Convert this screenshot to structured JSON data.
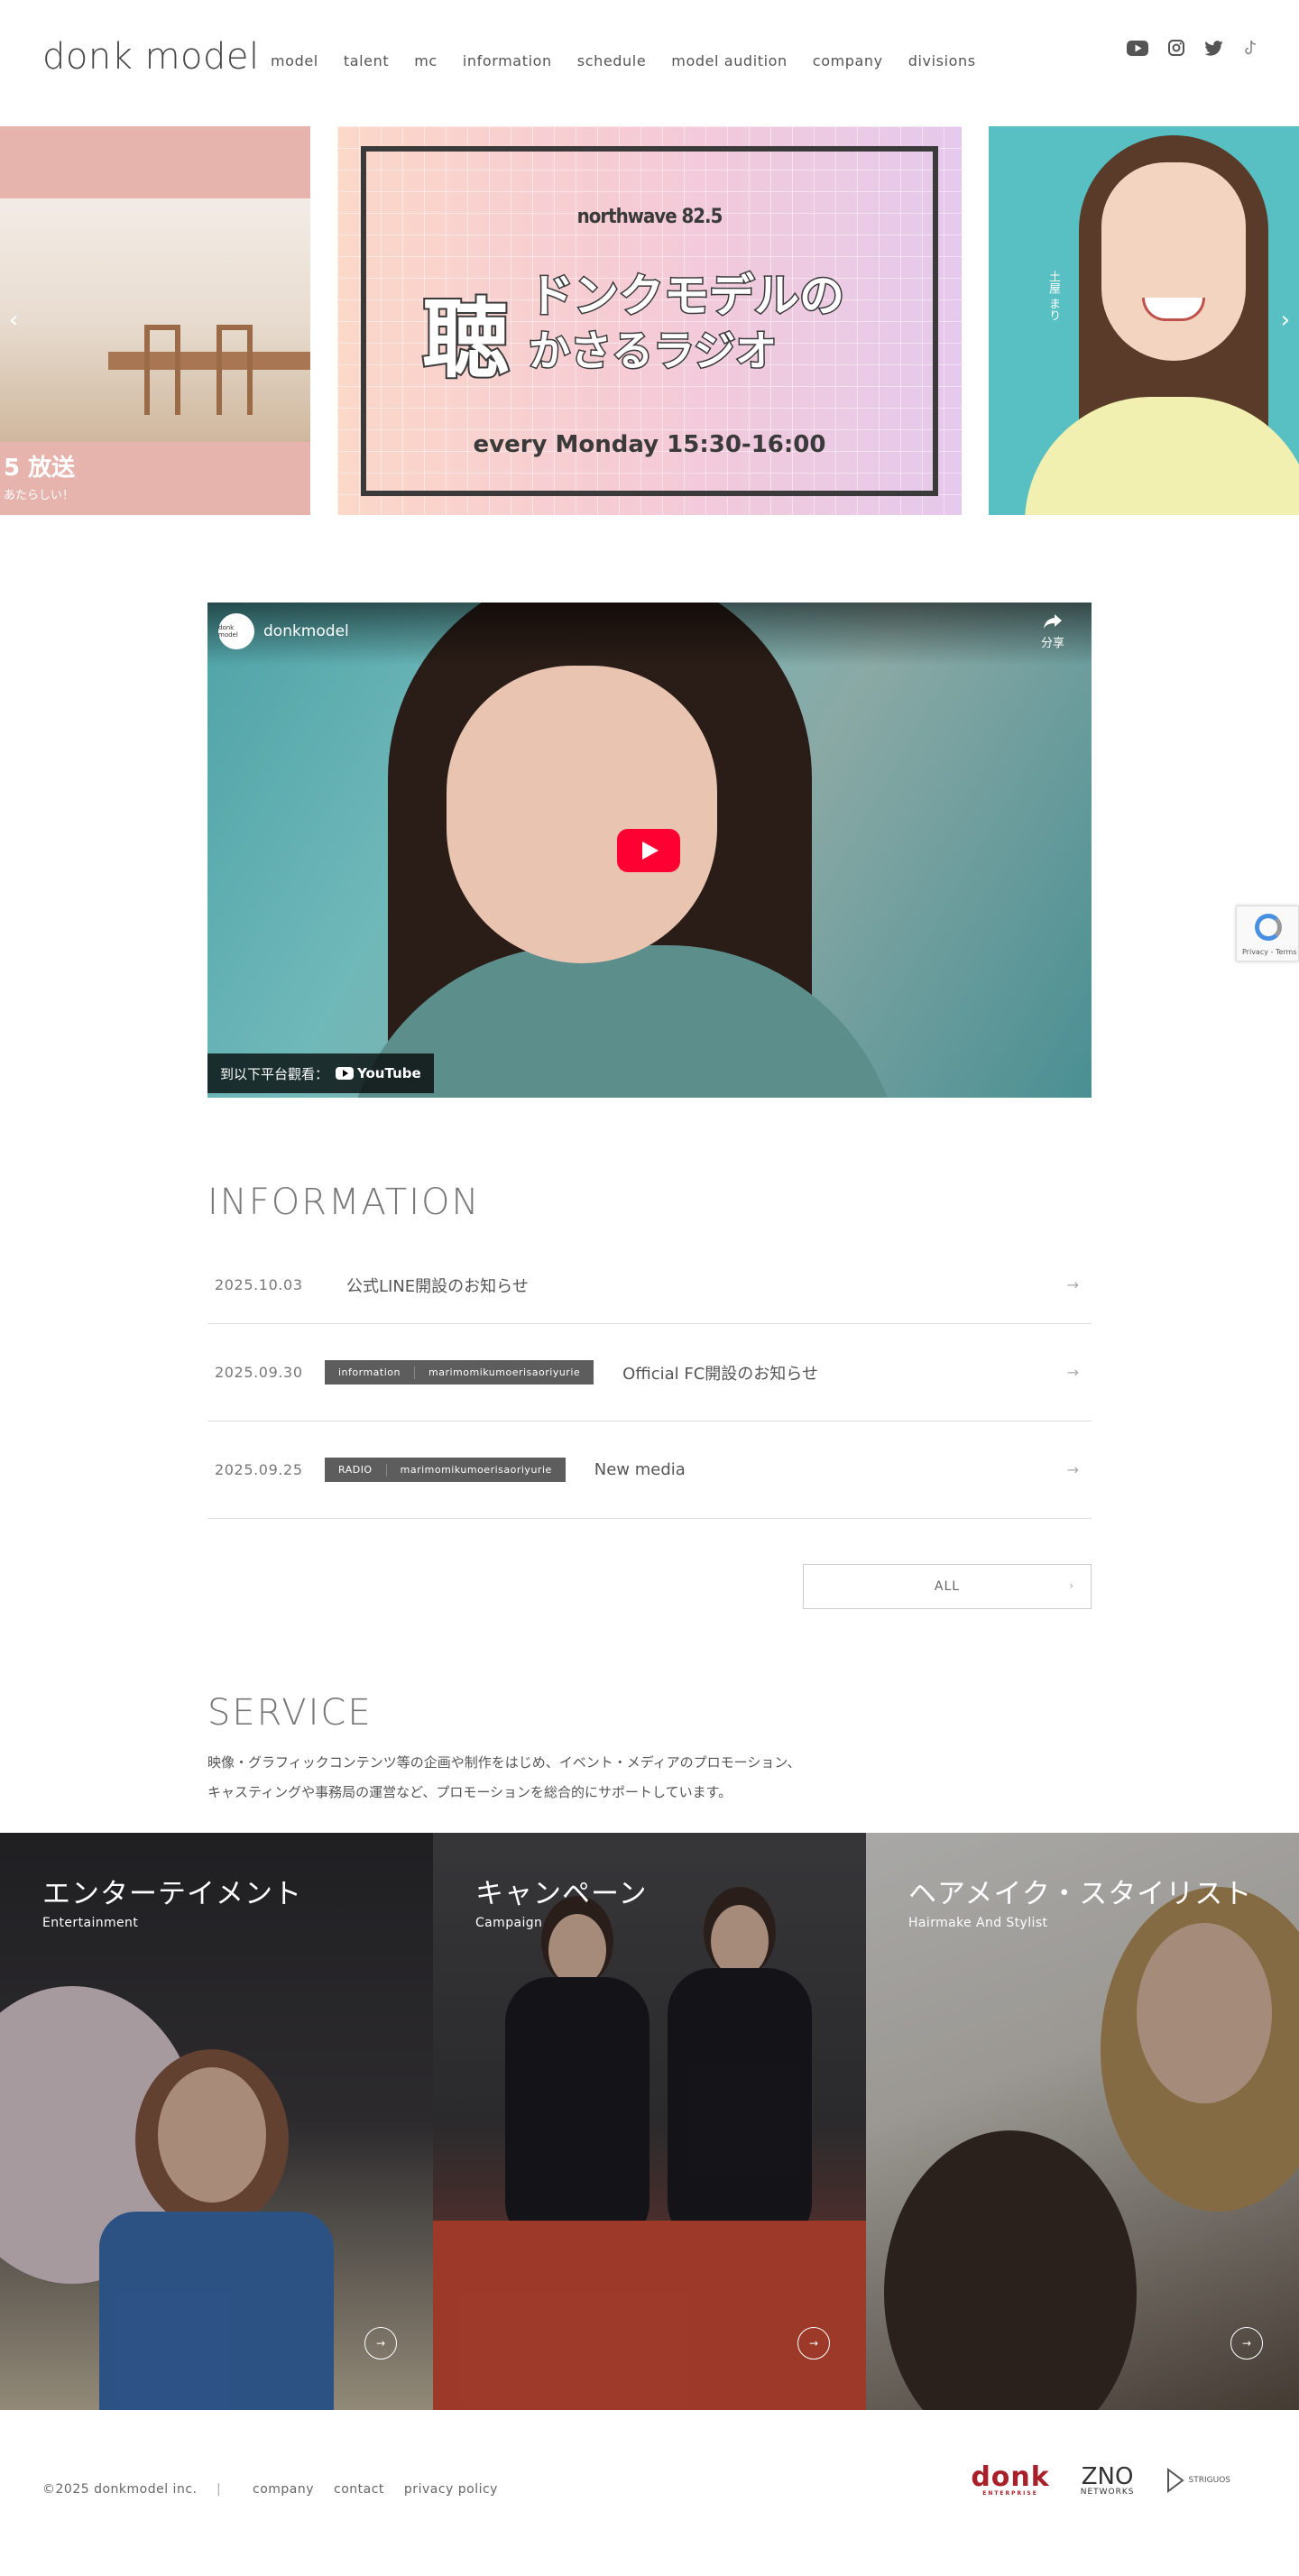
{
  "header": {
    "logo": "donk model",
    "nav": [
      "model",
      "talent",
      "mc",
      "information",
      "schedule",
      "model audition",
      "company",
      "divisions"
    ],
    "social_icons": [
      "youtube-icon",
      "instagram-icon",
      "twitter-icon",
      "tiktok-icon"
    ]
  },
  "slider": {
    "left_slide": {
      "text": "5 放送",
      "sub": "あたらしい！"
    },
    "center_slide": {
      "station": "northwave 82.5",
      "title_kanji": "聴",
      "title_line1": "ドンクモデルの",
      "title_line2": "かさるラジオ",
      "schedule": "every Monday 15:30-16:00"
    },
    "right_slide": {
      "name": "土屋 まり"
    }
  },
  "video": {
    "channel": "donkmodel",
    "channel_avatar": "donk model",
    "share_label": "分享",
    "watch_on": "到以下平台觀看：",
    "platform": "YouTube"
  },
  "recaptcha": {
    "label": "Privacy - Terms"
  },
  "information": {
    "title": "INFORMATION",
    "items": [
      {
        "date": "2025.10.03",
        "tags": [],
        "text": "公式LINE開設のお知らせ"
      },
      {
        "date": "2025.09.30",
        "tags": [
          "information",
          "marimomikumoerisaoriyurie"
        ],
        "text": "Official FC開設のお知らせ"
      },
      {
        "date": "2025.09.25",
        "tags": [
          "RADIO",
          "marimomikumoerisaoriyurie"
        ],
        "text": "New media"
      }
    ],
    "all_label": "ALL"
  },
  "service": {
    "title": "SERVICE",
    "desc_line1": "映像・グラフィックコンテンツ等の企画や制作をはじめ、イベント・メディアのプロモーション、",
    "desc_line2": "キャスティングや事務局の運営など、プロモーションを総合的にサポートしています。",
    "items": [
      {
        "title": "エンターテイメント",
        "sub": "Entertainment"
      },
      {
        "title": "キャンペーン",
        "sub": "Campaign"
      },
      {
        "title": "ヘアメイク・スタイリスト",
        "sub": "Hairmake And Stylist"
      }
    ]
  },
  "footer": {
    "copyright": "©2025 donkmodel inc.",
    "links": [
      "company",
      "contact",
      "privacy policy"
    ],
    "brands": {
      "donk": "donk",
      "donk_sub": "ENTERPRISE",
      "zno": "ZNO",
      "zno_sub": "NETWORKS",
      "stg": "STRIGUOS"
    }
  }
}
